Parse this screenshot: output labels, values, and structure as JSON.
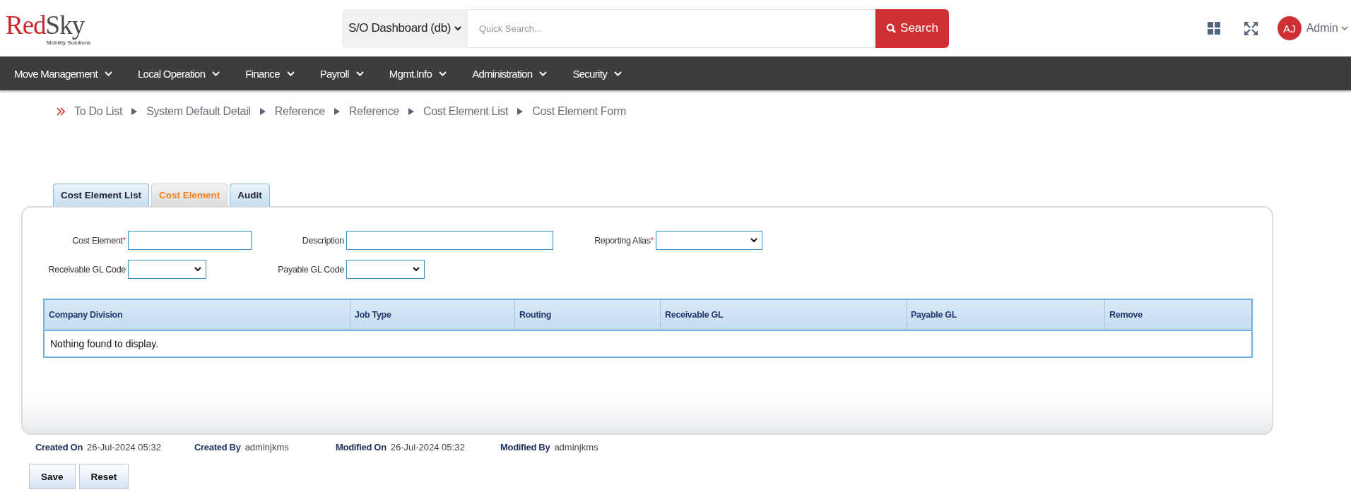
{
  "logo": {
    "word_first": "Red",
    "word_second": "Sky",
    "tagline": "Mobility Solutions"
  },
  "search": {
    "scope": "S/O Dashboard (db)",
    "placeholder": "Quick Search...",
    "button": "Search"
  },
  "user": {
    "initials": "AJ",
    "name": "Admin"
  },
  "nav": [
    "Move Management",
    "Local Operation",
    "Finance",
    "Payroll",
    "Mgmt.Info",
    "Administration",
    "Security"
  ],
  "breadcrumbs": [
    "To Do List",
    "System Default Detail",
    "Reference",
    "Reference",
    "Cost Element List",
    "Cost Element Form"
  ],
  "tabs": [
    {
      "label": "Cost Element List",
      "selected": false
    },
    {
      "label": "Cost Element",
      "selected": true
    },
    {
      "label": "Audit",
      "selected": false
    }
  ],
  "fields": [
    [
      {
        "label": "Cost Element",
        "kind": "text",
        "required_mark": "*"
      },
      {
        "label": "Description",
        "kind": "text"
      },
      {
        "label": "Reporting Alias",
        "kind": "select",
        "required_mark": "*"
      }
    ],
    [
      {
        "label": "Receivable GL Code",
        "kind": "select"
      },
      {
        "label": "Payable GL Code",
        "kind": "select"
      }
    ]
  ],
  "table": {
    "columns": [
      "Company Division",
      "Job Type",
      "Routing",
      "Receivable GL",
      "Payable GL",
      "Remove"
    ],
    "empty_message": "Nothing found to display."
  },
  "audit": [
    {
      "label": "Created On",
      "value": "26-Jul-2024 05:32"
    },
    {
      "label": "Created By",
      "value": "adminjkms"
    },
    {
      "label": "Modified On",
      "value": "26-Jul-2024 05:32"
    },
    {
      "label": "Modified By",
      "value": "adminjkms"
    }
  ],
  "buttons": [
    "Save",
    "Reset"
  ]
}
